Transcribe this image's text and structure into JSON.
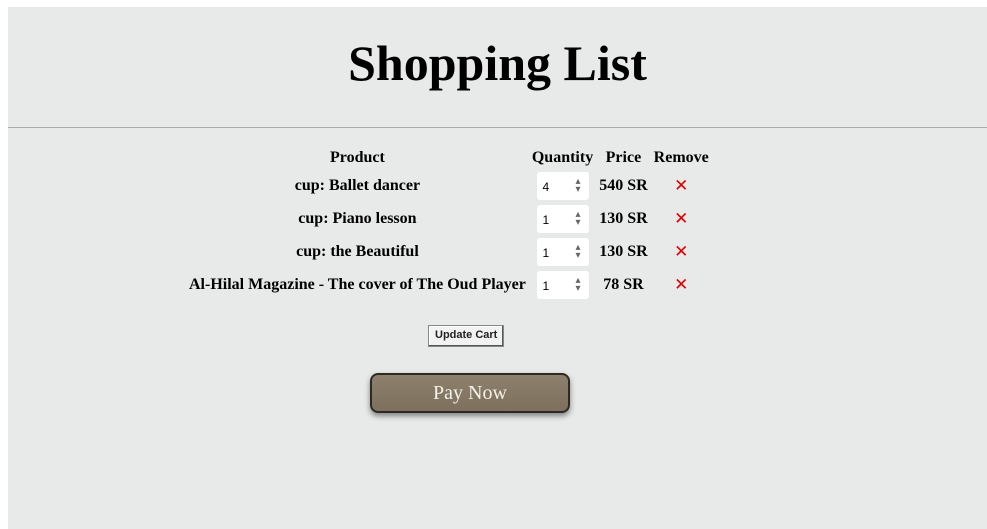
{
  "header": {
    "title": "Shopping List"
  },
  "table": {
    "columns": {
      "product": "Product",
      "quantity": "Quantity",
      "price": "Price",
      "remove": "Remove"
    },
    "rows": [
      {
        "product": "cup: Ballet dancer",
        "quantity": "4",
        "price": "540 SR",
        "remove": "✕"
      },
      {
        "product": "cup: Piano lesson",
        "quantity": "1",
        "price": "130 SR",
        "remove": "✕"
      },
      {
        "product": "cup: the Beautiful",
        "quantity": "1",
        "price": "130 SR",
        "remove": "✕"
      },
      {
        "product": "Al-Hilal Magazine - The cover of The Oud Player",
        "quantity": "1",
        "price": "78 SR",
        "remove": "✕"
      }
    ]
  },
  "actions": {
    "update_label": "Update Cart",
    "pay_label": "Pay Now"
  },
  "colors": {
    "background": "#e8e9e9",
    "remove": "#e00000",
    "pay_button": "#857865"
  }
}
